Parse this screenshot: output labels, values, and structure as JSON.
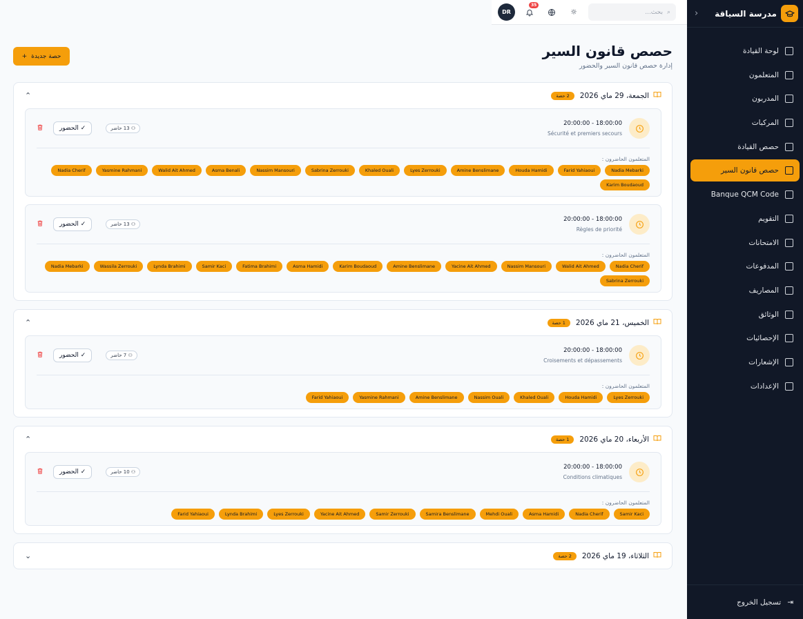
{
  "sidebar": {
    "brand": "مدرسة السياقة",
    "items": [
      {
        "label": "لوحة القيادة",
        "icon": "dashboard-icon"
      },
      {
        "label": "المتعلمون",
        "icon": "users-icon"
      },
      {
        "label": "المدربون",
        "icon": "user-cog-icon"
      },
      {
        "label": "المركبات",
        "icon": "car-icon"
      },
      {
        "label": "حصص القيادة",
        "icon": "book-open-icon"
      },
      {
        "label": "حصص قانون السير",
        "icon": "file-text-icon"
      },
      {
        "label": "Banque QCM Code",
        "icon": "brain-icon"
      },
      {
        "label": "التقويم",
        "icon": "calendar-icon"
      },
      {
        "label": "الامتحانات",
        "icon": "clipboard-check-icon"
      },
      {
        "label": "المدفوعات",
        "icon": "credit-card-icon"
      },
      {
        "label": "المصاريف",
        "icon": "receipt-icon"
      },
      {
        "label": "الوثائق",
        "icon": "file-edit-icon"
      },
      {
        "label": "الإحصائيات",
        "icon": "bar-chart-icon"
      },
      {
        "label": "الإشعارات",
        "icon": "bell-icon"
      },
      {
        "label": "الإعدادات",
        "icon": "settings-icon"
      }
    ],
    "logout": "تسجيل الخروج"
  },
  "topbar": {
    "search_placeholder": "بحث...",
    "notif_count": "35",
    "avatar": "DR"
  },
  "page": {
    "title": "حصص قانون السير",
    "subtitle": "إدارة حصص قانون السير والحضور",
    "new_button": "حصة جديدة"
  },
  "labels": {
    "attendance": "الحضور",
    "present_learners": "المتعلمون الحاضرون :"
  },
  "days": [
    {
      "title": "الجمعة، 29 ماي 2026",
      "badge": "2 حصة",
      "sessions": [
        {
          "time": "18:00:00 - 20:00:00",
          "topic": "Sécurité et premiers secours",
          "count": "13 حاضر",
          "learners": [
            "Nadia Mebarki",
            "Farid Yahiaoui",
            "Houda Hamidi",
            "Amine Benslimane",
            "Lyes Zerrouki",
            "Khaled Ouali",
            "Sabrina Zerrouki",
            "Nassim Mansouri",
            "Asma Benali",
            "Walid Ait Ahmed",
            "Yasmine Rahmani",
            "Nadia Cherif",
            "Karim Boudaoud"
          ]
        },
        {
          "time": "18:00:00 - 20:00:00",
          "topic": "Règles de priorité",
          "count": "13 حاضر",
          "learners": [
            "Nadia Cherif",
            "Walid Ait Ahmed",
            "Nassim Mansouri",
            "Yacine Ait Ahmed",
            "Amine Benslimane",
            "Karim Boudaoud",
            "Asma Hamidi",
            "Fatima Brahimi",
            "Samir Kaci",
            "Lynda Brahimi",
            "Wassila Zerrouki",
            "Nadia Mebarki",
            "Sabrina Zerrouki"
          ]
        }
      ]
    },
    {
      "title": "الخميس، 21 ماي 2026",
      "badge": "1 حصة",
      "sessions": [
        {
          "time": "18:00:00 - 20:00:00",
          "topic": "Croisements et dépassements",
          "count": "7 حاضر",
          "learners": [
            "Lyes Zerrouki",
            "Houda Hamidi",
            "Khaled Ouali",
            "Nassim Ouali",
            "Amine Benslimane",
            "Yasmine Rahmani",
            "Farid Yahiaoui"
          ]
        }
      ]
    },
    {
      "title": "الأربعاء، 20 ماي 2026",
      "badge": "1 حصة",
      "sessions": [
        {
          "time": "18:00:00 - 20:00:00",
          "topic": "Conditions climatiques",
          "count": "10 حاضر",
          "learners": [
            "Samir Kaci",
            "Nadia Cherif",
            "Asma Hamidi",
            "Mehdi Ouali",
            "Samira Benslimane",
            "Samir Zerrouki",
            "Yacine Ait Ahmed",
            "Lyes Zerrouki",
            "Lynda Brahimi",
            "Farid Yahiaoui"
          ]
        }
      ]
    },
    {
      "title": "الثلاثاء، 19 ماي 2026",
      "badge": "2 حصة",
      "collapsed": true,
      "sessions": []
    }
  ]
}
